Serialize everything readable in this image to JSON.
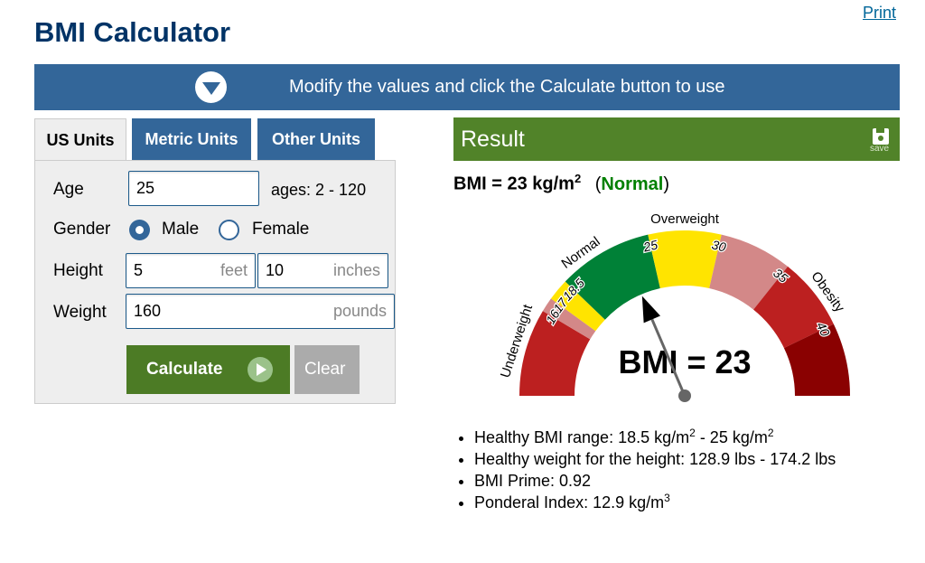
{
  "page": {
    "title": "BMI Calculator",
    "print_link": "Print",
    "banner_text": "Modify the values and click the Calculate button to use"
  },
  "tabs": [
    {
      "label": "US Units",
      "active": true
    },
    {
      "label": "Metric Units",
      "active": false
    },
    {
      "label": "Other Units",
      "active": false
    }
  ],
  "form": {
    "age": {
      "label": "Age",
      "value": "25",
      "hint": "ages: 2 - 120"
    },
    "gender": {
      "label": "Gender",
      "options": [
        "Male",
        "Female"
      ],
      "selected": "Male"
    },
    "height": {
      "label": "Height",
      "feet_value": "5",
      "feet_unit": "feet",
      "inches_value": "10",
      "inches_unit": "inches"
    },
    "weight": {
      "label": "Weight",
      "value": "160",
      "unit": "pounds"
    },
    "calculate_label": "Calculate",
    "clear_label": "Clear"
  },
  "result": {
    "header": "Result",
    "save_label": "save",
    "bmi_text": "BMI = 23 kg/m",
    "bmi_sup": "2",
    "class_open": "(",
    "class_label": "Normal",
    "class_close": ")",
    "gauge_label": "BMI = 23",
    "stats": [
      {
        "text": "Healthy BMI range: 18.5 kg/m",
        "sup": "2",
        "text2": " - 25 kg/m",
        "sup2": "2"
      },
      {
        "text": "Healthy weight for the height: 128.9 lbs - 174.2 lbs"
      },
      {
        "text": "BMI Prime: 0.92"
      },
      {
        "text": "Ponderal Index: 12.9 kg/m",
        "sup": "3"
      }
    ]
  },
  "gauge": {
    "min": 10,
    "max": 45,
    "value": 23,
    "segments": [
      {
        "from": 10,
        "to": 16,
        "color": "#bc2020"
      },
      {
        "from": 16,
        "to": 17,
        "color": "#d38888"
      },
      {
        "from": 17,
        "to": 18.5,
        "color": "#ffe400"
      },
      {
        "from": 18.5,
        "to": 25,
        "color": "#008137"
      },
      {
        "from": 25,
        "to": 30,
        "color": "#ffe400"
      },
      {
        "from": 30,
        "to": 35,
        "color": "#d38888"
      },
      {
        "from": 35,
        "to": 40,
        "color": "#bc2020"
      },
      {
        "from": 40,
        "to": 45,
        "color": "#8a0101"
      }
    ],
    "ticks": [
      "16",
      "17",
      "18.5",
      "25",
      "30",
      "35",
      "40"
    ],
    "categories": [
      {
        "label": "Underweight",
        "at": 13.5
      },
      {
        "label": "Normal",
        "at": 20.5
      },
      {
        "label": "Overweight",
        "at": 27.5
      },
      {
        "label": "Obesity",
        "at": 38
      }
    ]
  },
  "colors": {
    "title": "#003366",
    "banner": "#336699",
    "result_header": "#518329",
    "calculate": "#4c7b25",
    "normal_text": "#008000"
  }
}
